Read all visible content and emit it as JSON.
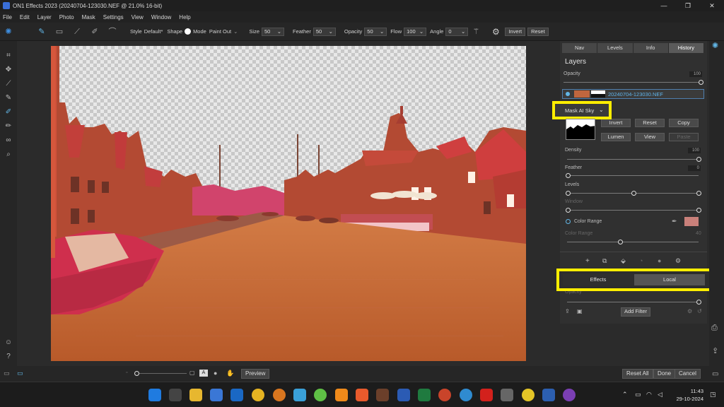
{
  "window": {
    "title": "ON1 Effects 2023 (20240704-123030.NEF @ 21.0% 16-bit)",
    "minimize": "—",
    "maximize": "❐",
    "close": "✕"
  },
  "menu": [
    "File",
    "Edit",
    "Layer",
    "Photo",
    "Mask",
    "Settings",
    "View",
    "Window",
    "Help"
  ],
  "toolbar": {
    "style_label": "Style",
    "style_value": "Default*",
    "shape_label": "Shape",
    "mode_label": "Mode",
    "mode_value": "Paint Out",
    "size_label": "Size",
    "size_value": "50",
    "feather_label": "Feather",
    "feather_value": "50",
    "opacity_label": "Opacity",
    "opacity_value": "50",
    "flow_label": "Flow",
    "flow_value": "100",
    "angle_label": "Angle",
    "angle_value": "0",
    "invert": "Invert",
    "reset": "Reset"
  },
  "bottom": {
    "preview": "Preview",
    "reset_all": "Reset All",
    "done": "Done",
    "cancel": "Cancel"
  },
  "panel": {
    "tabs": [
      {
        "label": "Nav"
      },
      {
        "label": "Levels"
      },
      {
        "label": "Info"
      },
      {
        "label": "History"
      }
    ],
    "title": "Layers",
    "opacity_label": "Opacity",
    "opacity_value": "100",
    "layer_name": "20240704-123030.NEF",
    "mask_dropdown": "Mask AI Sky",
    "buttons": {
      "invert": "Invert",
      "reset": "Reset",
      "copy": "Copy",
      "lumen": "Lumen",
      "view": "View",
      "paste": "Paste"
    },
    "density_label": "Density",
    "density_value": "100",
    "feather_label": "Feather",
    "feather_value": "0",
    "levels_label": "Levels",
    "window_label": "Window",
    "color_range_label": "Color Range",
    "color_range_sub_label": "Color Range",
    "color_range_value": "40",
    "effects_tab": "Effects",
    "local_tab": "Local",
    "opacity2_label": "Opacity",
    "add_filter": "Add Filter"
  },
  "tray": {
    "time": "11:43",
    "date": "29-10-2024"
  },
  "colors": {
    "accent": "#62b6e6",
    "highlight": "#ffee00",
    "swatch": "#c9807a"
  }
}
